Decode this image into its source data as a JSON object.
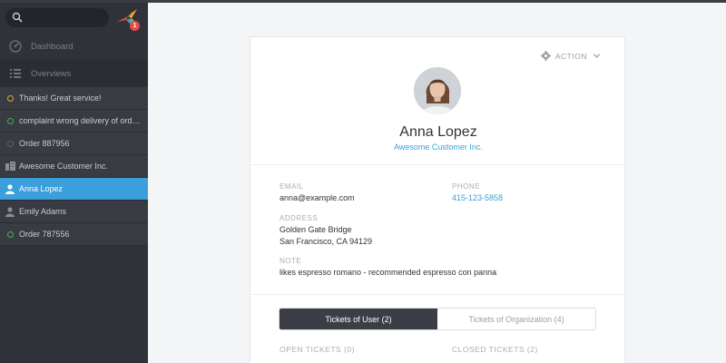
{
  "sidebar": {
    "search": {
      "placeholder": ""
    },
    "logo": {
      "badge_count": "1"
    },
    "nav": [
      {
        "label": "Dashboard",
        "icon": "dashboard-icon"
      },
      {
        "label": "Overviews",
        "icon": "list-icon"
      }
    ],
    "tasks": [
      {
        "label": "Thanks! Great service!",
        "icon": "ticket-dot-open-icon",
        "active": false
      },
      {
        "label": "complaint wrong delivery of ord…",
        "icon": "ticket-dot-green-icon",
        "active": false
      },
      {
        "label": "Order 887956",
        "icon": "ticket-dot-closed-icon",
        "active": false
      },
      {
        "label": "Awesome Customer Inc.",
        "icon": "organization-icon",
        "active": false
      },
      {
        "label": "Anna Lopez",
        "icon": "user-icon",
        "active": true
      },
      {
        "label": "Emily Adams",
        "icon": "user-icon",
        "active": false
      },
      {
        "label": "Order 787556",
        "icon": "ticket-dot-green-icon",
        "active": false
      }
    ]
  },
  "profile": {
    "action_label": "ACTION",
    "name": "Anna Lopez",
    "organization": "Awesome Customer Inc.",
    "fields": {
      "email_label": "EMAIL",
      "email_value": "anna@example.com",
      "phone_label": "PHONE",
      "phone_value": "415-123-5858",
      "address_label": "ADDRESS",
      "address_line1": "Golden Gate Bridge",
      "address_line2": "San Francisco, CA 94129",
      "note_label": "NOTE",
      "note_value": "likes espresso romano - recommended espresso con panna"
    },
    "tabs": [
      {
        "label": "Tickets of User (2)",
        "active": true
      },
      {
        "label": "Tickets of Organization (4)",
        "active": false
      }
    ],
    "open_tickets_label": "OPEN TICKETS (0)",
    "closed_tickets_label": "CLOSED TICKETS (2)"
  },
  "colors": {
    "sidebar_bg": "#2f3238",
    "active_blue": "#3a9fdb",
    "status_yellow": "#e6a33a",
    "status_green": "#3fb35a"
  }
}
